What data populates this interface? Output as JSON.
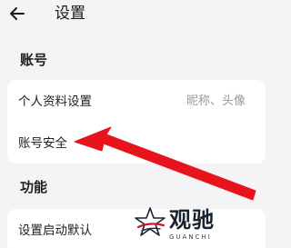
{
  "header": {
    "back_icon": "arrow-left-icon",
    "title": "设置"
  },
  "sections": {
    "account": {
      "title": "账号",
      "items": [
        {
          "label": "个人资料设置",
          "value": "昵称、头像"
        },
        {
          "label": "账号安全"
        }
      ]
    },
    "features": {
      "title": "功能",
      "items": [
        {
          "label": "设置启动默认"
        }
      ]
    }
  },
  "annotation": {
    "arrow_color": "#e8141c",
    "points_to": "账号安全"
  },
  "watermark": {
    "title": "观驰",
    "subtitle": "GUANCHI",
    "logo_icon": "star-logo-icon"
  },
  "colors": {
    "background": "#f4f4f6",
    "card": "#ffffff",
    "text_primary": "#1f1f1f",
    "text_secondary": "#999999"
  }
}
